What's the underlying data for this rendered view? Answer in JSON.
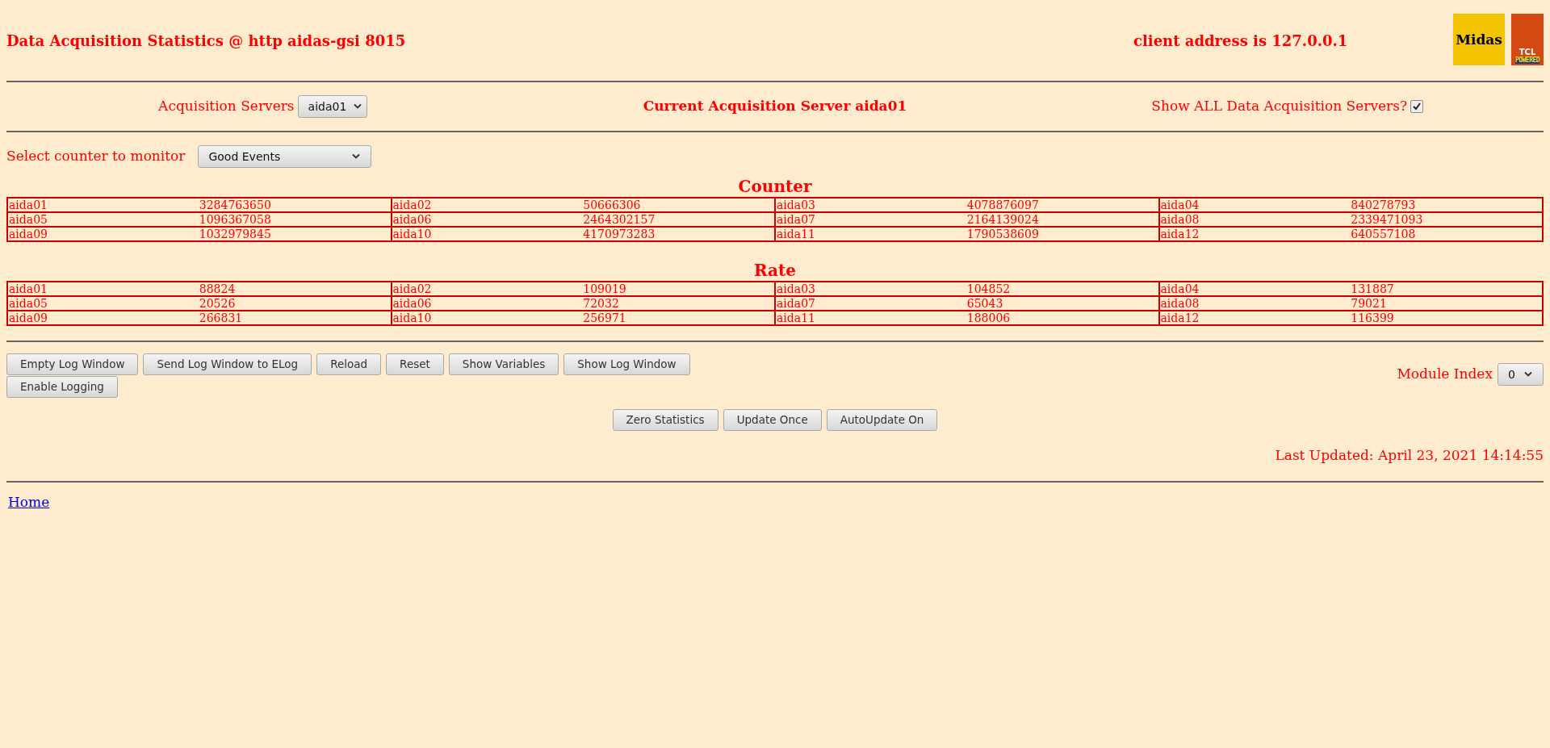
{
  "header": {
    "title": "Data Acquisition Statistics @ http aidas-gsi 8015",
    "client": "client address is 127.0.0.1",
    "logos": [
      {
        "kind": "midas",
        "text": "Midas"
      },
      {
        "kind": "tcl",
        "text": "TCL",
        "subtext": "POWERED"
      }
    ]
  },
  "servers": {
    "label": "Acquisition Servers",
    "value": "aida01",
    "current": "Current Acquisition Server aida01",
    "show_all": {
      "label": "Show ALL Data Acquisition Servers?",
      "checked": true
    }
  },
  "counter_select": {
    "label": "Select counter to monitor",
    "value": "Good Events"
  },
  "tables": [
    {
      "title": "Counter",
      "rows": [
        [
          {
            "name": "aida01",
            "value": "3284763650"
          },
          {
            "name": "aida02",
            "value": "50666306"
          },
          {
            "name": "aida03",
            "value": "4078876097"
          },
          {
            "name": "aida04",
            "value": "840278793"
          }
        ],
        [
          {
            "name": "aida05",
            "value": "1096367058"
          },
          {
            "name": "aida06",
            "value": "2464302157"
          },
          {
            "name": "aida07",
            "value": "2164139024"
          },
          {
            "name": "aida08",
            "value": "2339471093"
          }
        ],
        [
          {
            "name": "aida09",
            "value": "1032979845"
          },
          {
            "name": "aida10",
            "value": "4170973283"
          },
          {
            "name": "aida11",
            "value": "1790538609"
          },
          {
            "name": "aida12",
            "value": "640557108"
          }
        ]
      ]
    },
    {
      "title": "Rate",
      "rows": [
        [
          {
            "name": "aida01",
            "value": "88824"
          },
          {
            "name": "aida02",
            "value": "109019"
          },
          {
            "name": "aida03",
            "value": "104852"
          },
          {
            "name": "aida04",
            "value": "131887"
          }
        ],
        [
          {
            "name": "aida05",
            "value": "20526"
          },
          {
            "name": "aida06",
            "value": "72032"
          },
          {
            "name": "aida07",
            "value": "65043"
          },
          {
            "name": "aida08",
            "value": "79021"
          }
        ],
        [
          {
            "name": "aida09",
            "value": "266831"
          },
          {
            "name": "aida10",
            "value": "256971"
          },
          {
            "name": "aida11",
            "value": "188006"
          },
          {
            "name": "aida12",
            "value": "116399"
          }
        ]
      ]
    }
  ],
  "log_buttons": [
    "Empty Log Window",
    "Send Log Window to ELog",
    "Reload",
    "Reset",
    "Show Variables",
    "Show Log Window",
    "Enable Logging"
  ],
  "module_index": {
    "label": "Module Index",
    "value": "0"
  },
  "stat_buttons": [
    "Zero Statistics",
    "Update Once",
    "AutoUpdate On"
  ],
  "last_updated": "Last Updated: April 23, 2021 14:14:55",
  "footer_link": "Home"
}
